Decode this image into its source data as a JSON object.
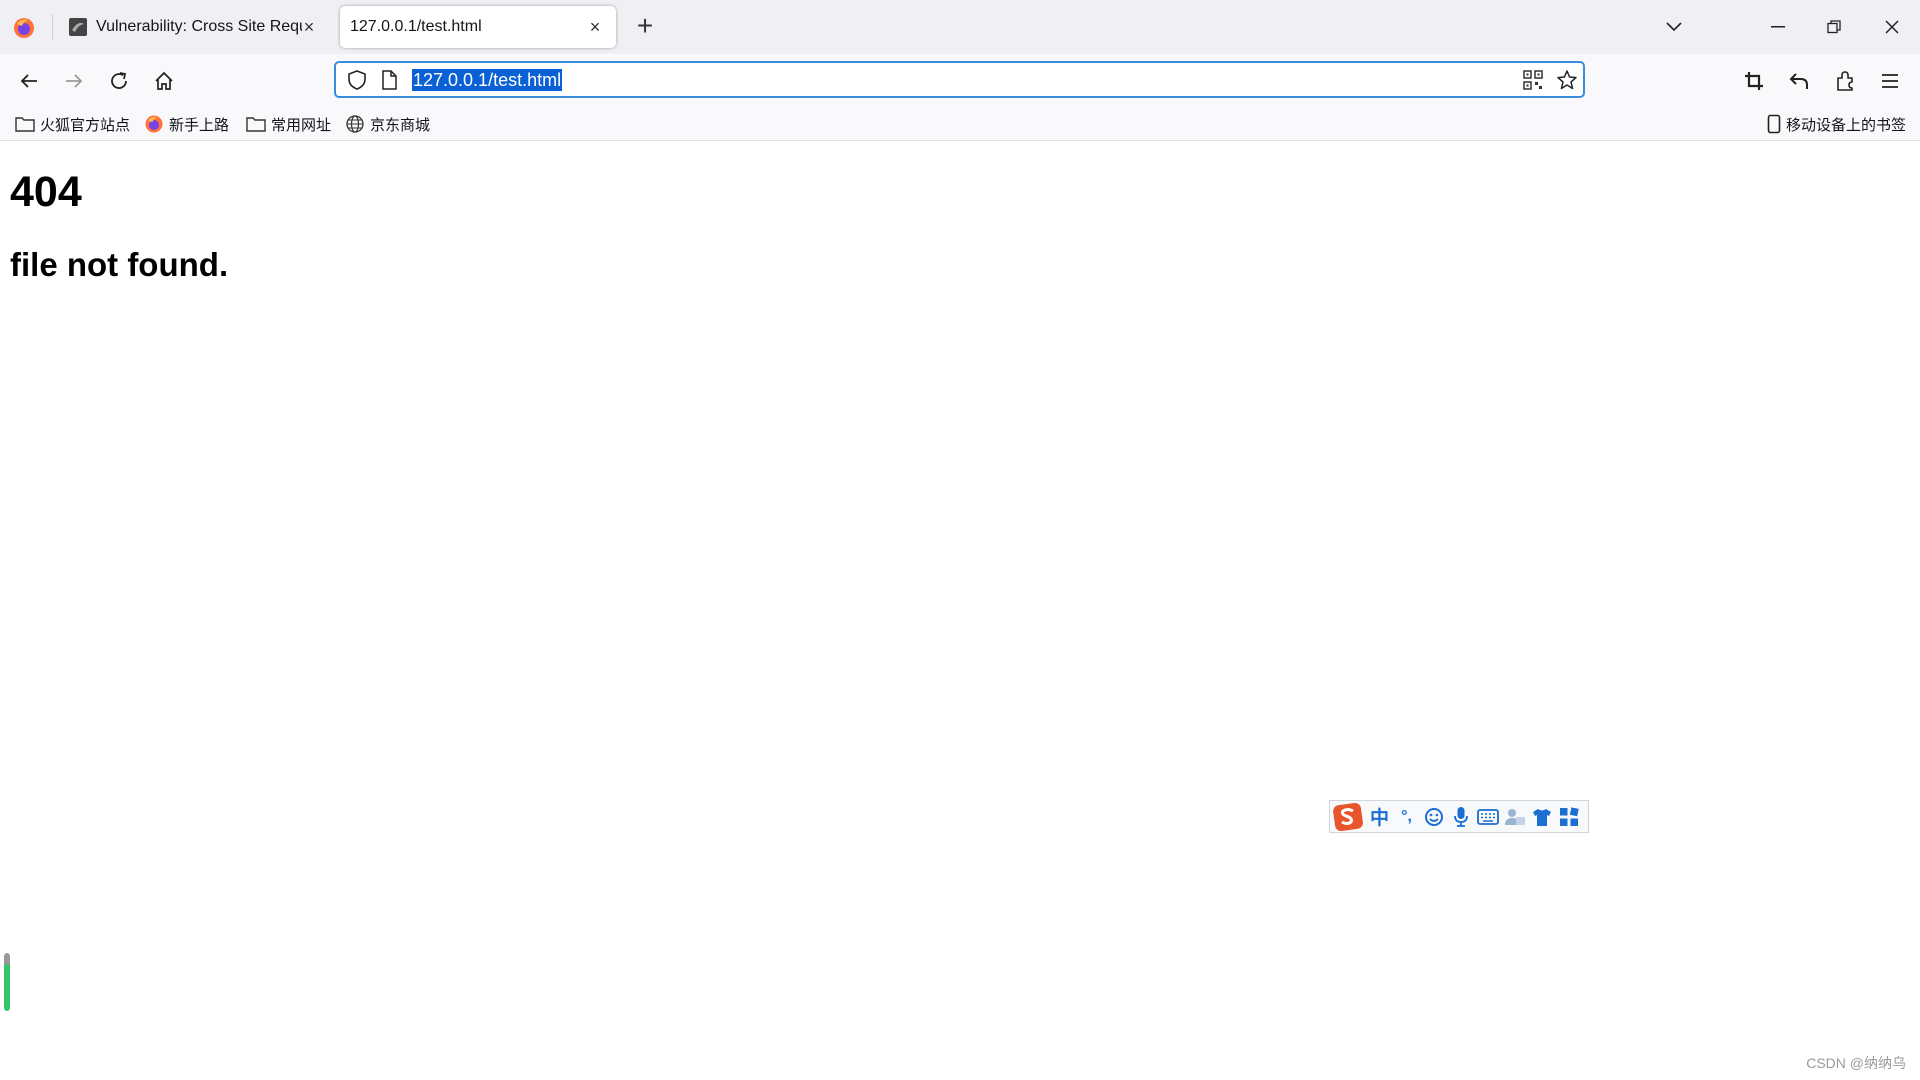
{
  "browser": {
    "tabs": [
      {
        "title": "Vulnerability: Cross Site Requ",
        "active": false,
        "close": "×"
      },
      {
        "title": "127.0.0.1/test.html",
        "active": true,
        "close": "×"
      }
    ],
    "new_tab": "+",
    "url": "127.0.0.1/test.html"
  },
  "bookmarks": [
    {
      "label": "火狐官方站点",
      "icon": "folder-icon"
    },
    {
      "label": "新手上路",
      "icon": "firefox-icon"
    },
    {
      "label": "常用网址",
      "icon": "folder-icon"
    },
    {
      "label": "京东商城",
      "icon": "globe-icon"
    }
  ],
  "mobile_bookmarks": "移动设备上的书签",
  "page": {
    "heading": "404",
    "subheading": "file not found."
  },
  "ime": {
    "mode": "中",
    "punct": "°,"
  },
  "watermark": "CSDN @纳纳乌",
  "colors": {
    "accent": "#0a61d6",
    "focus_ring": "#3a8cdc",
    "ime_brand": "#e8542b"
  }
}
